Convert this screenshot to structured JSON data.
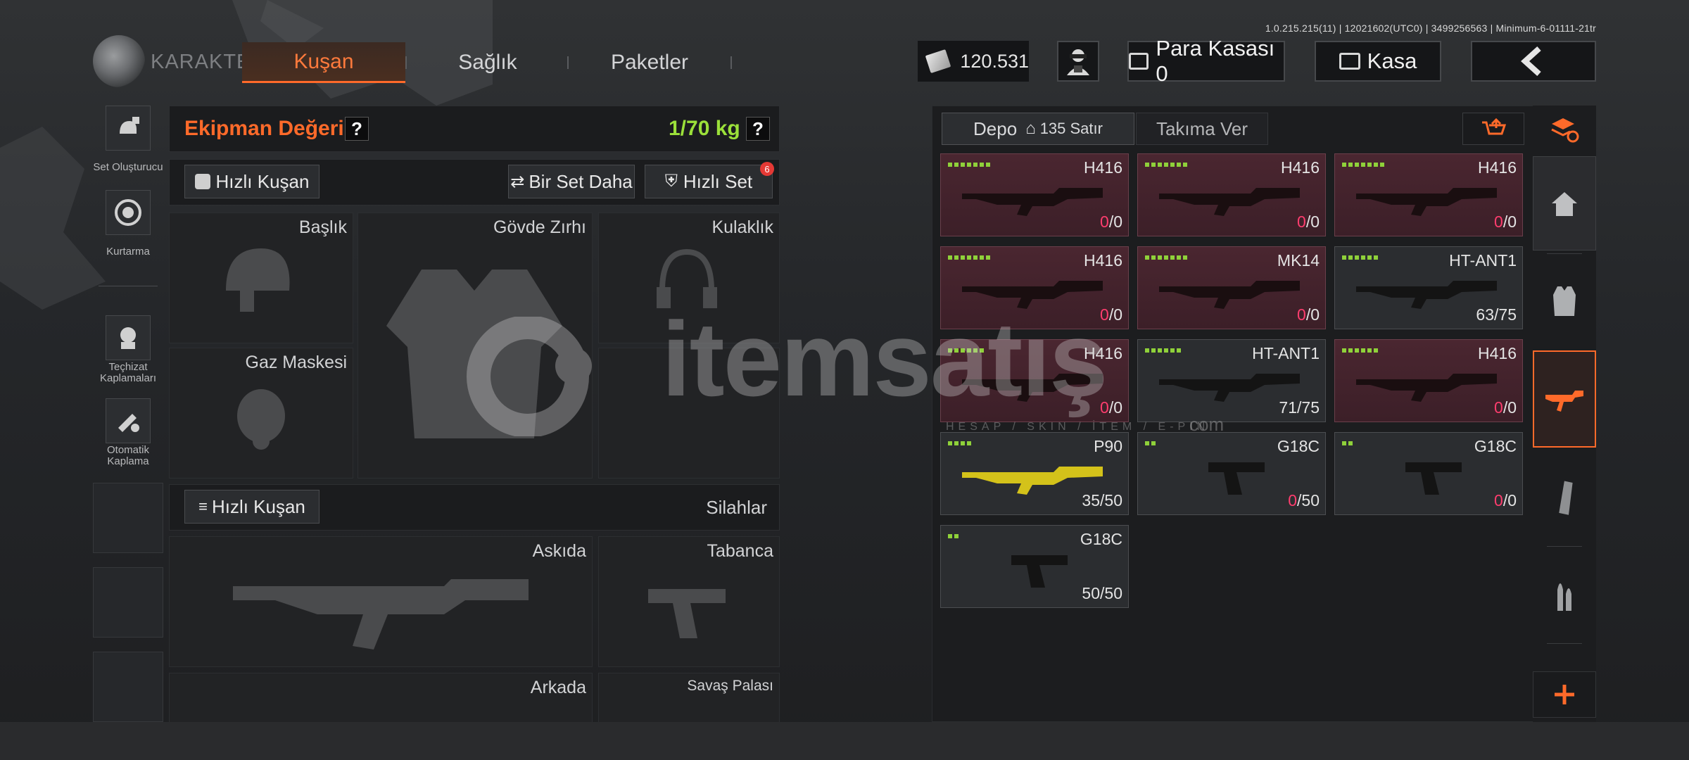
{
  "version_text": "1.0.215.215(11) | 12021602(UTC0) | 3499256563 | Minimum-6-01111-21tr",
  "nav": {
    "section_title": "KARAKTER",
    "tabs": [
      {
        "label": "Kuşan",
        "active": true
      },
      {
        "label": "Sağlık",
        "active": false
      },
      {
        "label": "Paketler",
        "active": false
      }
    ]
  },
  "currency": {
    "amount": "120.531"
  },
  "top_buttons": {
    "vault_label": "Para Kasası 0",
    "safe_label": "Kasa",
    "back_icon": "chevron-left-icon"
  },
  "sidebar": {
    "items": [
      {
        "label": "Set Oluşturucu",
        "icon": "set-builder-icon"
      },
      {
        "label": "Kurtarma",
        "icon": "rescue-icon"
      },
      {
        "label": "Teçhizat Kaplamaları",
        "icon": "gear-skin-icon"
      },
      {
        "label": "Otomatik Kaplama",
        "icon": "auto-skin-icon"
      }
    ]
  },
  "equipment": {
    "value_label": "Ekipman Değeri: 0",
    "help": "?",
    "weight": "1/70 kg",
    "quick_equip_label": "Hızlı Kuşan",
    "another_set_label": "Bir Set Daha",
    "quick_set_label": "Hızlı Set",
    "quick_set_badge": "6",
    "slots": {
      "helmet": "Başlık",
      "body_armor": "Gövde Zırhı",
      "headset": "Kulaklık",
      "gas_mask": "Gaz Maskesi"
    }
  },
  "weapons": {
    "quick_equip_label": "Hızlı Kuşan",
    "section_title": "Silahlar",
    "slots": {
      "slung": "Askıda",
      "pistol": "Tabanca",
      "back": "Arkada",
      "melee": "Savaş Palası"
    }
  },
  "inventory": {
    "tab_storage_label": "Depo",
    "tab_storage_rows": "135 Satır",
    "tab_team_label": "Takıma Ver",
    "items": [
      {
        "name": "H416",
        "count_now": "0",
        "count_max": "/0",
        "rarity": "red",
        "pips": 7
      },
      {
        "name": "H416",
        "count_now": "0",
        "count_max": "/0",
        "rarity": "red",
        "pips": 7
      },
      {
        "name": "H416",
        "count_now": "0",
        "count_max": "/0",
        "rarity": "red",
        "pips": 7
      },
      {
        "name": "H416",
        "count_now": "0",
        "count_max": "/0",
        "rarity": "red",
        "pips": 7
      },
      {
        "name": "MK14",
        "count_now": "0",
        "count_max": "/0",
        "rarity": "red",
        "pips": 7
      },
      {
        "name": "HT-ANT1",
        "count_now": "63",
        "count_max": "/75",
        "rarity": "grey",
        "pips": 6
      },
      {
        "name": "H416",
        "count_now": "0",
        "count_max": "/0",
        "rarity": "red",
        "pips": 6
      },
      {
        "name": "HT-ANT1",
        "count_now": "71",
        "count_max": "/75",
        "rarity": "grey",
        "pips": 6
      },
      {
        "name": "H416",
        "count_now": "0",
        "count_max": "/0",
        "rarity": "red",
        "pips": 6
      },
      {
        "name": "P90",
        "count_now": "35",
        "count_max": "/50",
        "rarity": "grey",
        "pips": 4
      },
      {
        "name": "G18C",
        "count_now": "0",
        "count_max": "/50",
        "rarity": "grey",
        "pips": 2
      },
      {
        "name": "G18C",
        "count_now": "0",
        "count_max": "/0",
        "rarity": "grey",
        "pips": 2
      },
      {
        "name": "G18C",
        "count_now": "50",
        "count_max": "/50",
        "rarity": "grey",
        "pips": 2
      }
    ]
  },
  "right_nav": [
    "refresh-stack-icon",
    "home-icon",
    "vest-icon",
    "rifle-icon",
    "magazine-icon",
    "ammo-icon",
    "plus-icon"
  ],
  "watermark": {
    "brand": "itemsatış",
    "sub": "HESAP / SKIN / İTEM / E-PIN",
    "suffix": "com"
  },
  "colors": {
    "accent": "#ff6a2a",
    "positive": "#9be03a",
    "zero_count": "#ff3d6e"
  }
}
